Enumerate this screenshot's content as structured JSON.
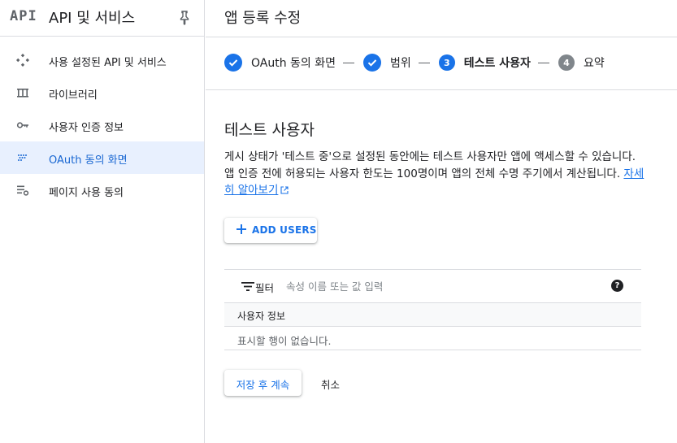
{
  "sidebar": {
    "logo": "API",
    "title": "API 및 서비스",
    "items": [
      {
        "label": "사용 설정된 API 및 서비스",
        "icon": "apis-icon",
        "active": false
      },
      {
        "label": "라이브러리",
        "icon": "library-icon",
        "active": false
      },
      {
        "label": "사용자 인증 정보",
        "icon": "key-icon",
        "active": false
      },
      {
        "label": "OAuth 동의 화면",
        "icon": "oauth-consent-icon",
        "active": true
      },
      {
        "label": "페이지 사용 동의",
        "icon": "page-usage-icon",
        "active": false
      }
    ]
  },
  "header": {
    "title": "앱 등록 수정"
  },
  "stepper": {
    "steps": [
      {
        "label": "OAuth 동의 화면",
        "state": "done",
        "number": ""
      },
      {
        "label": "범위",
        "state": "done",
        "number": ""
      },
      {
        "label": "테스트 사용자",
        "state": "current",
        "number": "3"
      },
      {
        "label": "요약",
        "state": "todo",
        "number": "4"
      }
    ]
  },
  "content": {
    "section_title": "테스트 사용자",
    "description": "게시 상태가 '테스트 중'으로 설정된 동안에는 테스트 사용자만 앱에 액세스할 수 있습니다. 앱 인증 전에 허용되는 사용자 한도는 100명이며 앱의 전체 수명 주기에서 계산됩니다.",
    "learn_more": "자세히 알아보기",
    "add_users_label": "ADD USERS"
  },
  "table": {
    "filter_label": "필터",
    "filter_placeholder": "속성 이름 또는 값 입력",
    "column_header": "사용자 정보",
    "empty_text": "표시할 행이 없습니다."
  },
  "actions": {
    "save_label": "저장 후 계속",
    "cancel_label": "취소"
  },
  "colors": {
    "accent": "#1a73e8",
    "active_bg": "#e8f0fe",
    "inactive_step": "#80868b"
  }
}
